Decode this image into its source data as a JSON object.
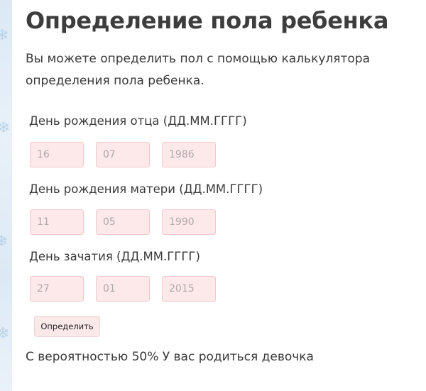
{
  "page": {
    "title": "Определение пола ребенка",
    "intro": "Вы можете определить пол с помощью калькулятора определения пола ребенка."
  },
  "form": {
    "father": {
      "label": "День рождения отца (ДД.ММ.ГГГГ)",
      "day": "16",
      "month": "07",
      "year": "1986"
    },
    "mother": {
      "label": "День рождения матери (ДД.ММ.ГГГГ)",
      "day": "11",
      "month": "05",
      "year": "1990"
    },
    "conception": {
      "label": "День зачатия (ДД.ММ.ГГГГ)",
      "day": "27",
      "month": "01",
      "year": "2015"
    },
    "submit_label": "Определить"
  },
  "result": {
    "text": "С вероятностью 50% У вас родиться девочка"
  },
  "colors": {
    "input_background": "#fde8ea",
    "input_border": "#f3c9cd",
    "heading_text": "#3d3d3d",
    "side_decoration": "#dbe9f5"
  },
  "icons": {
    "side_decoration": "snowflake-icon"
  }
}
